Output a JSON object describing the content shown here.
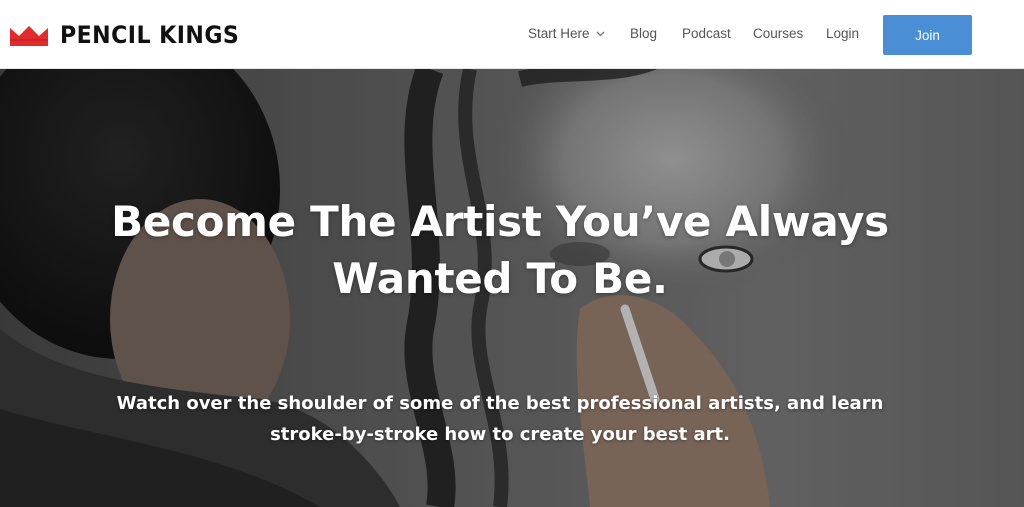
{
  "brand": {
    "name": "PENCIL KINGS",
    "logo_icon": "crown-icon",
    "logo_color": "#e32b2b"
  },
  "nav": {
    "items": [
      {
        "label": "Start Here",
        "has_dropdown": true
      },
      {
        "label": "Blog"
      },
      {
        "label": "Podcast"
      },
      {
        "label": "Courses"
      },
      {
        "label": "Login"
      }
    ],
    "join_label": "Join",
    "join_color": "#4a8fd6"
  },
  "hero": {
    "title_line1": "Become The Artist You’ve Always",
    "title_line2": "Wanted To Be.",
    "subtitle_line1": "Watch over the shoulder of some of the best professional artists, and learn",
    "subtitle_line2": "stroke-by-stroke how to create your best art."
  }
}
